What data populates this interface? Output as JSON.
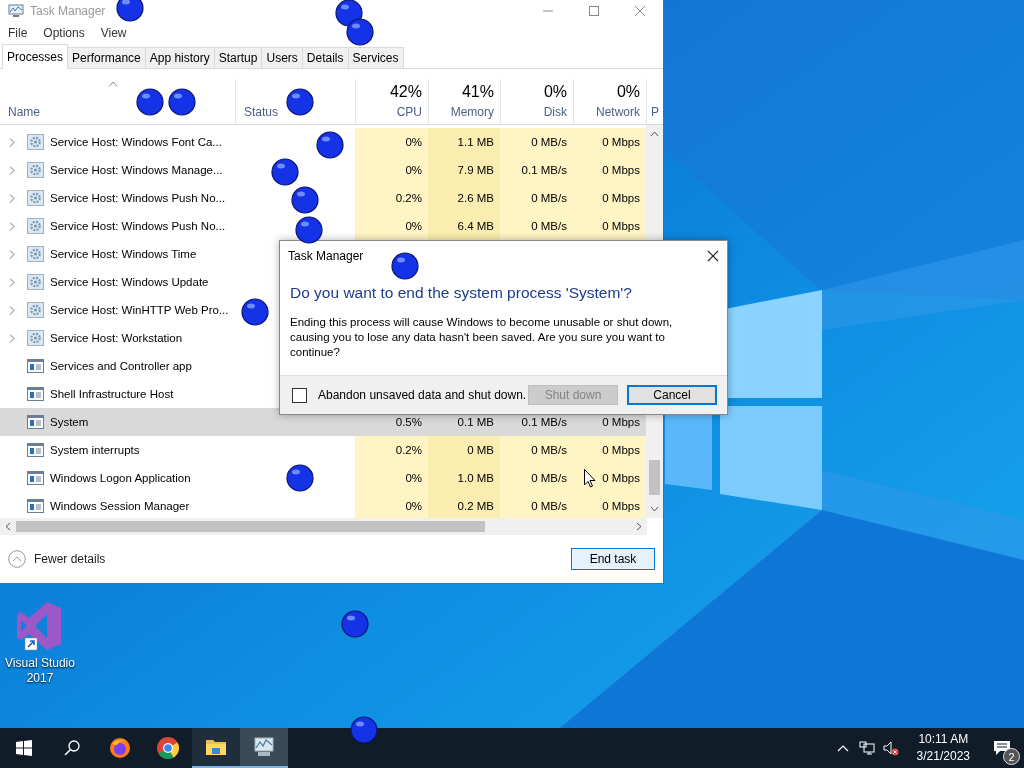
{
  "window": {
    "title": "Task Manager"
  },
  "menu": [
    "File",
    "Options",
    "View"
  ],
  "tabs": [
    {
      "label": "Processes",
      "selected": true
    },
    {
      "label": "Performance",
      "selected": false
    },
    {
      "label": "App history",
      "selected": false
    },
    {
      "label": "Startup",
      "selected": false
    },
    {
      "label": "Users",
      "selected": false
    },
    {
      "label": "Details",
      "selected": false
    },
    {
      "label": "Services",
      "selected": false
    }
  ],
  "name_column": {
    "label": "Name"
  },
  "status_column": {
    "label": "Status"
  },
  "metric_columns": [
    {
      "total": "42%",
      "label": "CPU"
    },
    {
      "total": "41%",
      "label": "Memory"
    },
    {
      "total": "0%",
      "label": "Disk"
    },
    {
      "total": "0%",
      "label": "Network"
    }
  ],
  "column_8": {
    "label": "P"
  },
  "rows": [
    {
      "name": "Service Host: Windows Font Ca...",
      "kind": "service",
      "expandable": true,
      "selected": false,
      "cpu": "0%",
      "memory": "1.1 MB",
      "disk": "0 MB/s",
      "network": "0 Mbps"
    },
    {
      "name": "Service Host: Windows Manage...",
      "kind": "service",
      "expandable": true,
      "selected": false,
      "cpu": "0%",
      "memory": "7.9 MB",
      "disk": "0.1 MB/s",
      "network": "0 Mbps"
    },
    {
      "name": "Service Host: Windows Push No...",
      "kind": "service",
      "expandable": true,
      "selected": false,
      "cpu": "0.2%",
      "memory": "2.6 MB",
      "disk": "0 MB/s",
      "network": "0 Mbps"
    },
    {
      "name": "Service Host: Windows Push No...",
      "kind": "service",
      "expandable": true,
      "selected": false,
      "cpu": "0%",
      "memory": "6.4 MB",
      "disk": "0 MB/s",
      "network": "0 Mbps"
    },
    {
      "name": "Service Host: Windows Time",
      "kind": "service",
      "expandable": true,
      "selected": false
    },
    {
      "name": "Service Host: Windows Update",
      "kind": "service",
      "expandable": true,
      "selected": false
    },
    {
      "name": "Service Host: WinHTTP Web Pro...",
      "kind": "service",
      "expandable": true,
      "selected": false
    },
    {
      "name": "Service Host: Workstation",
      "kind": "service",
      "expandable": true,
      "selected": false
    },
    {
      "name": "Services and Controller app",
      "kind": "app",
      "expandable": false,
      "selected": false
    },
    {
      "name": "Shell Infrastructure Host",
      "kind": "app",
      "expandable": false,
      "selected": false
    },
    {
      "name": "System",
      "kind": "app",
      "expandable": false,
      "selected": true,
      "cpu": "0.5%",
      "memory": "0.1 MB",
      "disk": "0.1 MB/s",
      "network": "0 Mbps"
    },
    {
      "name": "System interrupts",
      "kind": "app",
      "expandable": false,
      "selected": false,
      "cpu": "0.2%",
      "memory": "0 MB",
      "disk": "0 MB/s",
      "network": "0 Mbps"
    },
    {
      "name": "Windows Logon Application",
      "kind": "app",
      "expandable": false,
      "selected": false,
      "cpu": "0%",
      "memory": "1.0 MB",
      "disk": "0 MB/s",
      "network": "0 Mbps"
    },
    {
      "name": "Windows Session Manager",
      "kind": "app",
      "expandable": false,
      "selected": false,
      "cpu": "0%",
      "memory": "0.2 MB",
      "disk": "0 MB/s",
      "network": "0 Mbps"
    }
  ],
  "footer": {
    "details_toggle": "Fewer details",
    "end_task": "End task"
  },
  "dialog": {
    "title": "Task Manager",
    "heading": "Do you want to end the system process 'System'?",
    "message": "Ending this process will cause Windows to become unusable or shut down, causing you to lose any data hasn't been saved. Are you sure you want to continue?",
    "checkbox": {
      "label": "Abandon unsaved data and shut down.",
      "checked": false
    },
    "buttons": [
      {
        "label": "Shut down",
        "disabled": true,
        "default": false
      },
      {
        "label": "Cancel",
        "disabled": false,
        "default": true
      }
    ]
  },
  "desktop_icons": [
    {
      "label": "Visual Studio 2017"
    }
  ],
  "taskbar": {
    "apps": [
      {
        "kind": "firefox",
        "open": false,
        "active": false
      },
      {
        "kind": "chrome",
        "open": false,
        "active": false
      },
      {
        "kind": "explorer",
        "open": true,
        "active": false
      },
      {
        "kind": "taskmanager",
        "open": true,
        "active": true
      }
    ],
    "volume_muted": true,
    "time": "10:11 AM",
    "date": "3/21/2023",
    "notification_count": "2"
  }
}
